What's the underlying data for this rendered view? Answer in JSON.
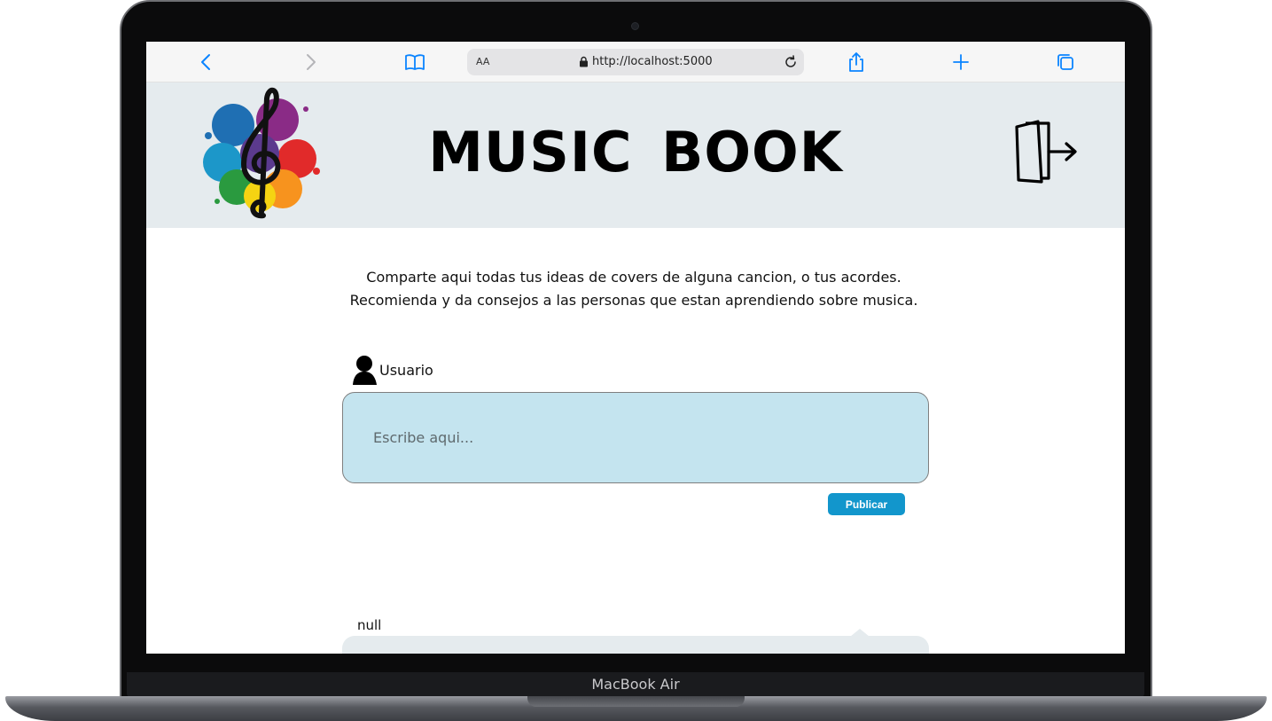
{
  "device": {
    "label": "MacBook Air"
  },
  "browser": {
    "text_size_label": "AA",
    "url": "http://localhost:5000",
    "icons": {
      "back": "chevron-left-icon",
      "forward": "chevron-right-icon",
      "bookmarks": "book-icon",
      "reload": "reload-icon",
      "share": "share-icon",
      "new_tab": "plus-icon",
      "tabs": "tabs-icon"
    },
    "accent_color": "#0a84ff"
  },
  "header": {
    "title": "MUSIC  BOOK",
    "logo": "treble-clef-paint-splash-logo",
    "logout_icon": "logout-door-icon",
    "background": "#e5ebee"
  },
  "intro": {
    "line1": "Comparte aqui todas tus ideas de covers de alguna cancion, o tus acordes.",
    "line2": "Recomienda y da consejos a las personas que estan aprendiendo sobre musica."
  },
  "composer": {
    "user_label": "Usuario",
    "placeholder": "Escribe aqui...",
    "publish_label": "Publicar",
    "box_color": "#c4e4ef",
    "button_color": "#1296cc"
  },
  "posts": [
    {
      "author": "null"
    }
  ]
}
